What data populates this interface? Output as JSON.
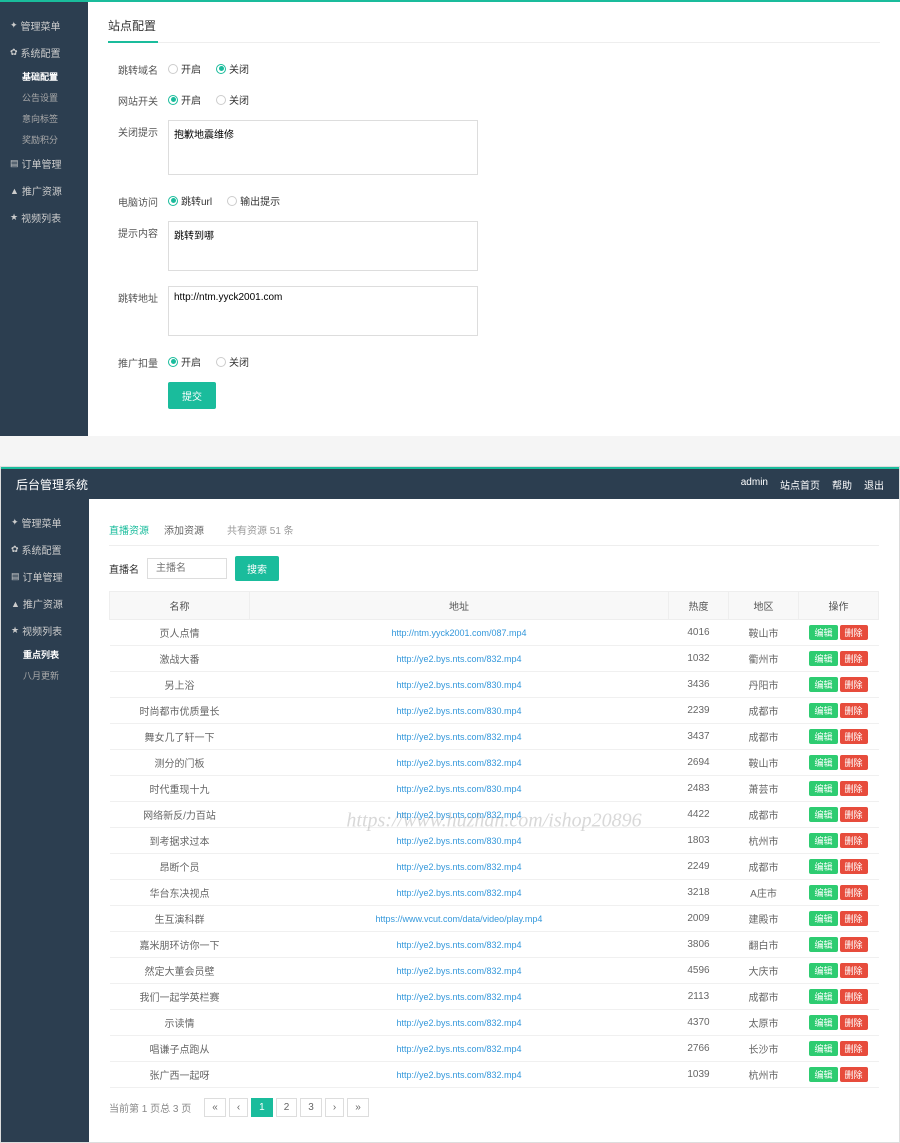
{
  "panel1": {
    "sidebar": {
      "items": [
        {
          "label": "管理菜单",
          "icon": "✦"
        },
        {
          "label": "系统配置",
          "icon": "✿",
          "subs": [
            {
              "label": "基础配置",
              "active": true
            },
            {
              "label": "公告设置"
            },
            {
              "label": "意向标签"
            },
            {
              "label": "奖励积分"
            }
          ]
        },
        {
          "label": "订单管理",
          "icon": "▤"
        },
        {
          "label": "推广资源",
          "icon": "▲"
        },
        {
          "label": "视频列表",
          "icon": "★"
        }
      ]
    },
    "pageTitle": "站点配置",
    "form": {
      "row1": {
        "label": "跳转域名",
        "opt1": "开启",
        "opt2": "关闭",
        "selected": 2
      },
      "row2": {
        "label": "网站开关",
        "opt1": "开启",
        "opt2": "关闭",
        "selected": 1
      },
      "row3": {
        "label": "关闭提示",
        "value": "抱歉地震维修"
      },
      "row4": {
        "label": "电脑访问",
        "opt1": "跳转url",
        "opt2": "输出提示",
        "selected": 1
      },
      "row5": {
        "label": "提示内容",
        "value": "跳转到哪"
      },
      "row6": {
        "label": "跳转地址",
        "value": "http://ntm.yyck2001.com"
      },
      "row7": {
        "label": "推广扣量",
        "opt1": "开启",
        "opt2": "关闭",
        "selected": 1
      },
      "submit": "提交"
    }
  },
  "panel2": {
    "topbar": {
      "title": "后台管理系统",
      "right": [
        "admin",
        "站点首页",
        "帮助",
        "退出"
      ]
    },
    "sidebar": {
      "items": [
        {
          "label": "管理菜单",
          "icon": "✦"
        },
        {
          "label": "系统配置",
          "icon": "✿"
        },
        {
          "label": "订单管理",
          "icon": "▤"
        },
        {
          "label": "推广资源",
          "icon": "▲"
        },
        {
          "label": "视频列表",
          "icon": "★",
          "subs": [
            {
              "label": "重点列表",
              "active": true
            },
            {
              "label": "八月更新"
            }
          ]
        }
      ]
    },
    "tabs": {
      "tab1": "直播资源",
      "tab2": "添加资源",
      "count": "共有资源 51 条"
    },
    "search": {
      "label": "直播名",
      "placeholder": "主播名",
      "button": "搜索"
    },
    "table": {
      "headers": [
        "名称",
        "地址",
        "热度",
        "地区",
        "操作"
      ],
      "editLabel": "编辑",
      "delLabel": "删除",
      "rows": [
        {
          "name": "页人点情",
          "url": "http://ntm.yyck2001.com/087.mp4",
          "heat": "4016",
          "area": "鞍山市"
        },
        {
          "name": "激战大番",
          "url": "http://ye2.bys.nts.com/832.mp4",
          "heat": "1032",
          "area": "衢州市"
        },
        {
          "name": "另上浴",
          "url": "http://ye2.bys.nts.com/830.mp4",
          "heat": "3436",
          "area": "丹阳市"
        },
        {
          "name": "时尚都市优质量长",
          "url": "http://ye2.bys.nts.com/830.mp4",
          "heat": "2239",
          "area": "成都市"
        },
        {
          "name": "舞女几了轩一下",
          "url": "http://ye2.bys.nts.com/832.mp4",
          "heat": "3437",
          "area": "成都市"
        },
        {
          "name": "测分的门板",
          "url": "http://ye2.bys.nts.com/832.mp4",
          "heat": "2694",
          "area": "鞍山市"
        },
        {
          "name": "时代重现十九",
          "url": "http://ye2.bys.nts.com/830.mp4",
          "heat": "2483",
          "area": "萧芸市"
        },
        {
          "name": "网络新反/力百站",
          "url": "http://ye2.bys.nts.com/832.mp4",
          "heat": "4422",
          "area": "成都市"
        },
        {
          "name": "到考据求过本",
          "url": "http://ye2.bys.nts.com/830.mp4",
          "heat": "1803",
          "area": "杭州市"
        },
        {
          "name": "昂断个员",
          "url": "http://ye2.bys.nts.com/832.mp4",
          "heat": "2249",
          "area": "成都市"
        },
        {
          "name": "华台东决视点",
          "url": "http://ye2.bys.nts.com/832.mp4",
          "heat": "3218",
          "area": "A庄市"
        },
        {
          "name": "生互演科群",
          "url": "https://www.vcut.com/data/video/play.mp4",
          "heat": "2009",
          "area": "建殿市"
        },
        {
          "name": "嘉米朋环访你一下",
          "url": "http://ye2.bys.nts.com/832.mp4",
          "heat": "3806",
          "area": "翻白市"
        },
        {
          "name": "然定大董会员壁",
          "url": "http://ye2.bys.nts.com/832.mp4",
          "heat": "4596",
          "area": "大庆市"
        },
        {
          "name": "我们一起学英栏赛",
          "url": "http://ye2.bys.nts.com/832.mp4",
          "heat": "2113",
          "area": "成都市"
        },
        {
          "name": "示读情",
          "url": "http://ye2.bys.nts.com/832.mp4",
          "heat": "4370",
          "area": "太原市"
        },
        {
          "name": "唱谦子点跑从",
          "url": "http://ye2.bys.nts.com/832.mp4",
          "heat": "2766",
          "area": "长沙市"
        },
        {
          "name": "张广西一起呀",
          "url": "http://ye2.bys.nts.com/832.mp4",
          "heat": "1039",
          "area": "杭州市"
        }
      ]
    },
    "pagination": {
      "info": "当前第 1 页总 3 页",
      "first": "«",
      "prev": "‹",
      "pages": [
        "1",
        "2",
        "3"
      ],
      "next": "›",
      "last": "»"
    },
    "watermark": "https://www.huzhan.com/ishop20896"
  }
}
